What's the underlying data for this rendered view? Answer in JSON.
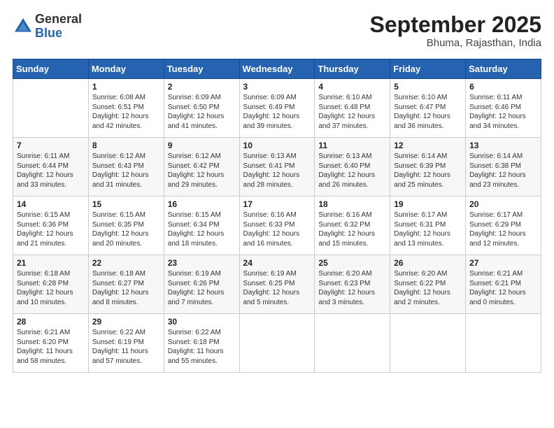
{
  "logo": {
    "general": "General",
    "blue": "Blue"
  },
  "title": "September 2025",
  "subtitle": "Bhuma, Rajasthan, India",
  "days_header": [
    "Sunday",
    "Monday",
    "Tuesday",
    "Wednesday",
    "Thursday",
    "Friday",
    "Saturday"
  ],
  "weeks": [
    [
      {
        "day": "",
        "info": ""
      },
      {
        "day": "1",
        "info": "Sunrise: 6:08 AM\nSunset: 6:51 PM\nDaylight: 12 hours\nand 42 minutes."
      },
      {
        "day": "2",
        "info": "Sunrise: 6:09 AM\nSunset: 6:50 PM\nDaylight: 12 hours\nand 41 minutes."
      },
      {
        "day": "3",
        "info": "Sunrise: 6:09 AM\nSunset: 6:49 PM\nDaylight: 12 hours\nand 39 minutes."
      },
      {
        "day": "4",
        "info": "Sunrise: 6:10 AM\nSunset: 6:48 PM\nDaylight: 12 hours\nand 37 minutes."
      },
      {
        "day": "5",
        "info": "Sunrise: 6:10 AM\nSunset: 6:47 PM\nDaylight: 12 hours\nand 36 minutes."
      },
      {
        "day": "6",
        "info": "Sunrise: 6:11 AM\nSunset: 6:46 PM\nDaylight: 12 hours\nand 34 minutes."
      }
    ],
    [
      {
        "day": "7",
        "info": "Sunrise: 6:11 AM\nSunset: 6:44 PM\nDaylight: 12 hours\nand 33 minutes."
      },
      {
        "day": "8",
        "info": "Sunrise: 6:12 AM\nSunset: 6:43 PM\nDaylight: 12 hours\nand 31 minutes."
      },
      {
        "day": "9",
        "info": "Sunrise: 6:12 AM\nSunset: 6:42 PM\nDaylight: 12 hours\nand 29 minutes."
      },
      {
        "day": "10",
        "info": "Sunrise: 6:13 AM\nSunset: 6:41 PM\nDaylight: 12 hours\nand 28 minutes."
      },
      {
        "day": "11",
        "info": "Sunrise: 6:13 AM\nSunset: 6:40 PM\nDaylight: 12 hours\nand 26 minutes."
      },
      {
        "day": "12",
        "info": "Sunrise: 6:14 AM\nSunset: 6:39 PM\nDaylight: 12 hours\nand 25 minutes."
      },
      {
        "day": "13",
        "info": "Sunrise: 6:14 AM\nSunset: 6:38 PM\nDaylight: 12 hours\nand 23 minutes."
      }
    ],
    [
      {
        "day": "14",
        "info": "Sunrise: 6:15 AM\nSunset: 6:36 PM\nDaylight: 12 hours\nand 21 minutes."
      },
      {
        "day": "15",
        "info": "Sunrise: 6:15 AM\nSunset: 6:35 PM\nDaylight: 12 hours\nand 20 minutes."
      },
      {
        "day": "16",
        "info": "Sunrise: 6:15 AM\nSunset: 6:34 PM\nDaylight: 12 hours\nand 18 minutes."
      },
      {
        "day": "17",
        "info": "Sunrise: 6:16 AM\nSunset: 6:33 PM\nDaylight: 12 hours\nand 16 minutes."
      },
      {
        "day": "18",
        "info": "Sunrise: 6:16 AM\nSunset: 6:32 PM\nDaylight: 12 hours\nand 15 minutes."
      },
      {
        "day": "19",
        "info": "Sunrise: 6:17 AM\nSunset: 6:31 PM\nDaylight: 12 hours\nand 13 minutes."
      },
      {
        "day": "20",
        "info": "Sunrise: 6:17 AM\nSunset: 6:29 PM\nDaylight: 12 hours\nand 12 minutes."
      }
    ],
    [
      {
        "day": "21",
        "info": "Sunrise: 6:18 AM\nSunset: 6:28 PM\nDaylight: 12 hours\nand 10 minutes."
      },
      {
        "day": "22",
        "info": "Sunrise: 6:18 AM\nSunset: 6:27 PM\nDaylight: 12 hours\nand 8 minutes."
      },
      {
        "day": "23",
        "info": "Sunrise: 6:19 AM\nSunset: 6:26 PM\nDaylight: 12 hours\nand 7 minutes."
      },
      {
        "day": "24",
        "info": "Sunrise: 6:19 AM\nSunset: 6:25 PM\nDaylight: 12 hours\nand 5 minutes."
      },
      {
        "day": "25",
        "info": "Sunrise: 6:20 AM\nSunset: 6:23 PM\nDaylight: 12 hours\nand 3 minutes."
      },
      {
        "day": "26",
        "info": "Sunrise: 6:20 AM\nSunset: 6:22 PM\nDaylight: 12 hours\nand 2 minutes."
      },
      {
        "day": "27",
        "info": "Sunrise: 6:21 AM\nSunset: 6:21 PM\nDaylight: 12 hours\nand 0 minutes."
      }
    ],
    [
      {
        "day": "28",
        "info": "Sunrise: 6:21 AM\nSunset: 6:20 PM\nDaylight: 11 hours\nand 58 minutes."
      },
      {
        "day": "29",
        "info": "Sunrise: 6:22 AM\nSunset: 6:19 PM\nDaylight: 11 hours\nand 57 minutes."
      },
      {
        "day": "30",
        "info": "Sunrise: 6:22 AM\nSunset: 6:18 PM\nDaylight: 11 hours\nand 55 minutes."
      },
      {
        "day": "",
        "info": ""
      },
      {
        "day": "",
        "info": ""
      },
      {
        "day": "",
        "info": ""
      },
      {
        "day": "",
        "info": ""
      }
    ]
  ]
}
